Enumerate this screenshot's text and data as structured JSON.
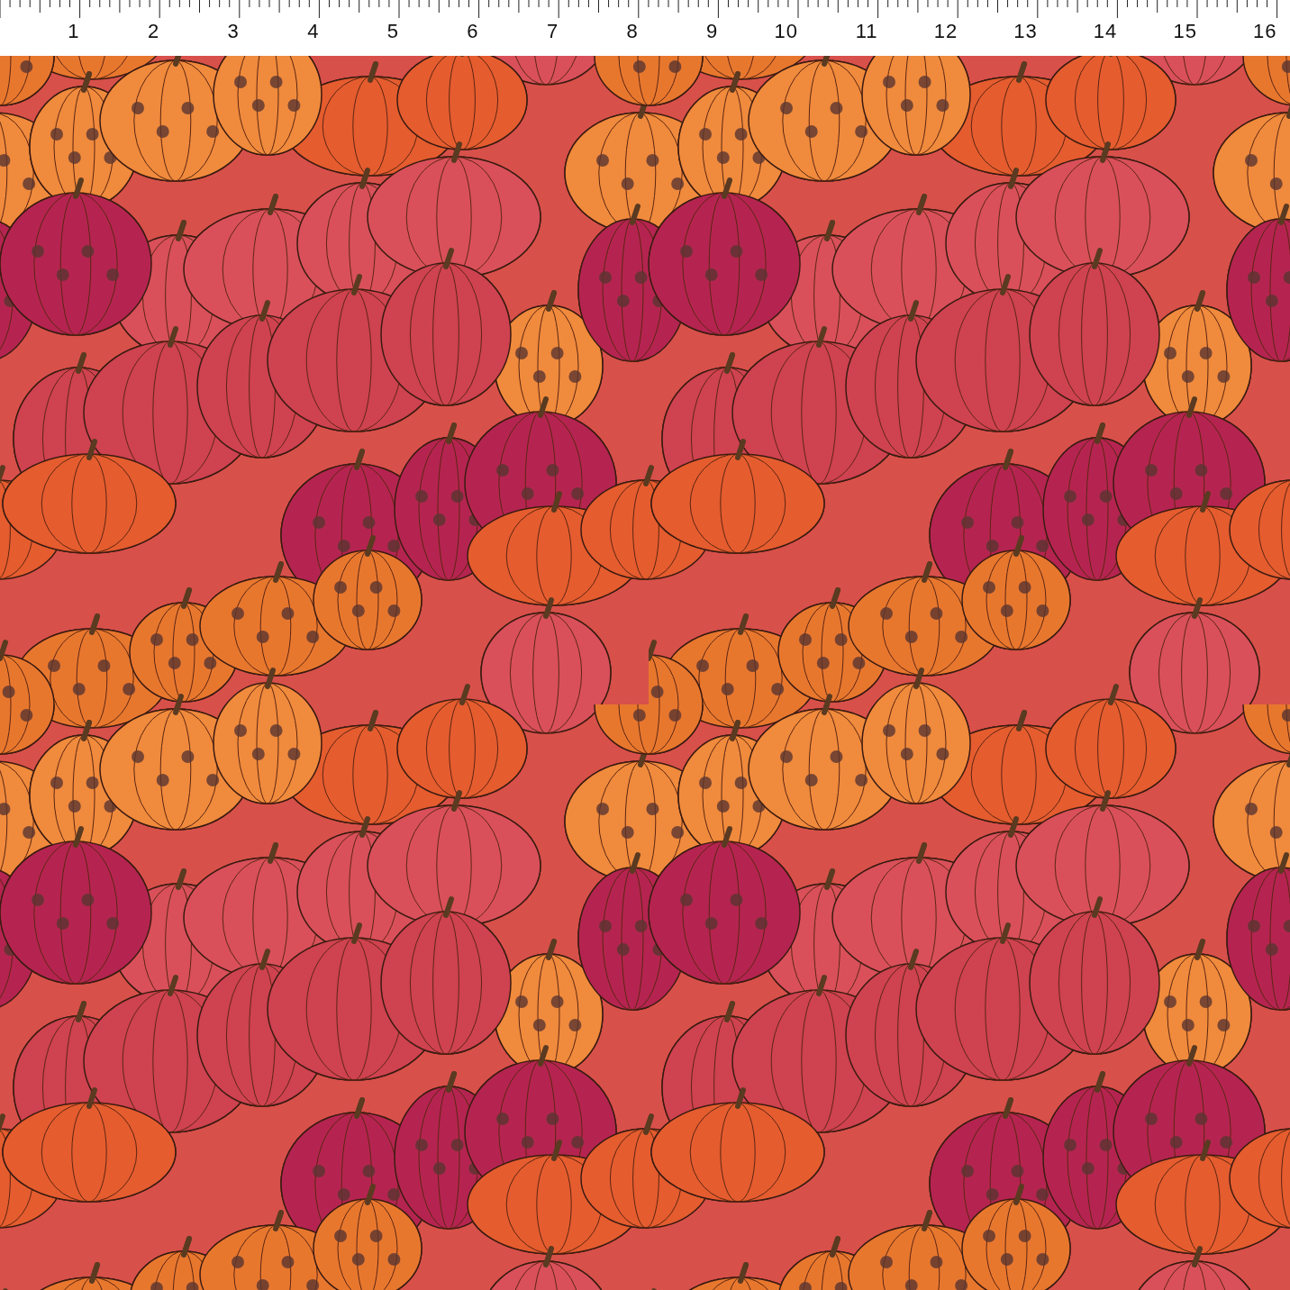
{
  "ruler": {
    "labels": [
      "1",
      "2",
      "3",
      "4",
      "5",
      "6",
      "7",
      "8",
      "9",
      "10",
      "11",
      "12",
      "13",
      "14",
      "15",
      "16"
    ]
  }
}
